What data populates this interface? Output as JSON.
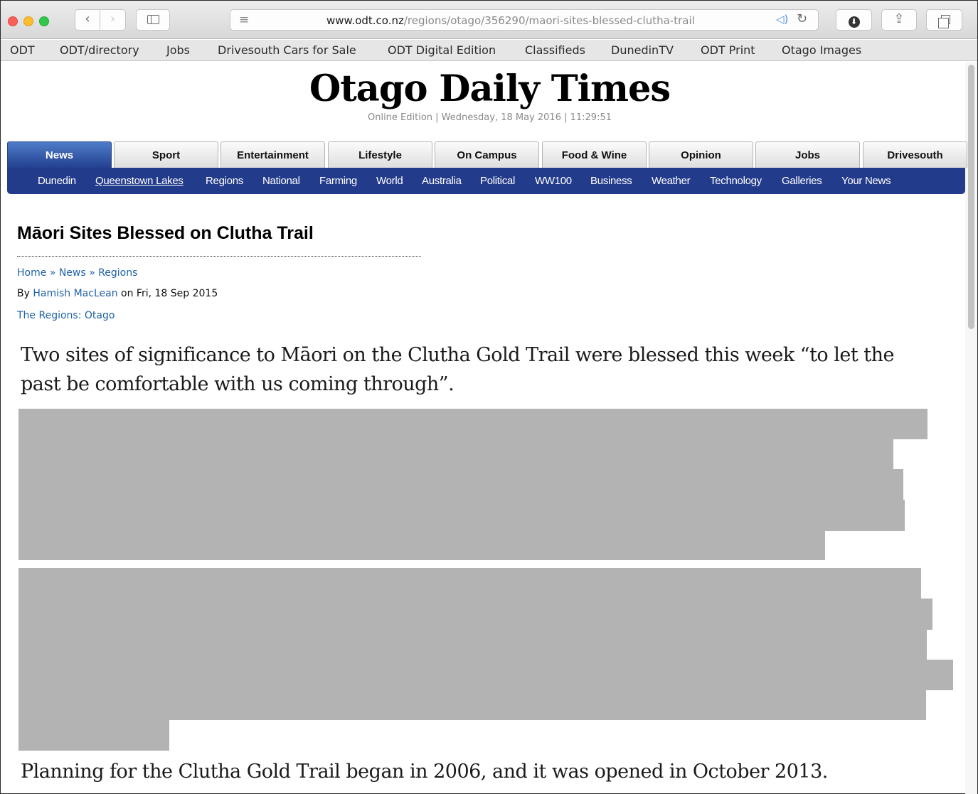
{
  "browser": {
    "url_host": "www.odt.co.nz",
    "url_path": "/regions/otago/356290/maori-sites-blessed-clutha-trail",
    "back_glyph": "‹",
    "forward_glyph": "›",
    "reader_glyph": "≡",
    "speaker_glyph": "◁)",
    "reload_glyph": "↻",
    "download_glyph": "⬇",
    "share_glyph": "⇪",
    "icons": [
      "back-icon",
      "forward-icon",
      "sidebar-icon",
      "reader-icon",
      "speaker-icon",
      "reload-icon",
      "download-icon",
      "share-icon",
      "tabs-icon"
    ]
  },
  "bookmarks": [
    "ODT",
    "ODT/directory",
    "Jobs",
    "Drivesouth Cars for Sale",
    "ODT Digital Edition",
    "Classifieds",
    "DunedinTV",
    "ODT Print",
    "Otago Images"
  ],
  "site": {
    "masthead": "Otago Daily Times",
    "edition": "Online Edition | Wednesday, 18 May 2016 | 11:29:51"
  },
  "main_nav": {
    "active": "News",
    "tabs": [
      "News",
      "Sport",
      "Entertainment",
      "Lifestyle",
      "On Campus",
      "Food & Wine",
      "Opinion",
      "Jobs",
      "Drivesouth"
    ]
  },
  "sub_nav": {
    "current": "Queenstown Lakes",
    "items": [
      "Dunedin",
      "Queenstown Lakes",
      "Regions",
      "National",
      "Farming",
      "World",
      "Australia",
      "Political",
      "WW100",
      "Business",
      "Weather",
      "Technology",
      "Galleries",
      "Your News"
    ]
  },
  "article": {
    "headline": "Māori Sites Blessed on Clutha Trail",
    "breadcrumb": [
      "Home",
      "News",
      "Regions"
    ],
    "breadcrumb_separator": "»",
    "byline_prefix": "By",
    "author": "Hamish MacLean",
    "date_text": "on Fri, 18 Sep 2015",
    "region_link": "The Regions: Otago",
    "lede_lines": [
      "Two sites of significance to Māori on the Clutha Gold Trail were blessed this week “to let the",
      "past be comfortable with us coming through”."
    ],
    "closing": "Planning for the Clutha Gold Trail began in 2006, and it was opened in October 2013."
  },
  "colors": {
    "link": "#1f62a8",
    "nav_blue": "#233b8b",
    "redaction": "#b3b3b3"
  }
}
